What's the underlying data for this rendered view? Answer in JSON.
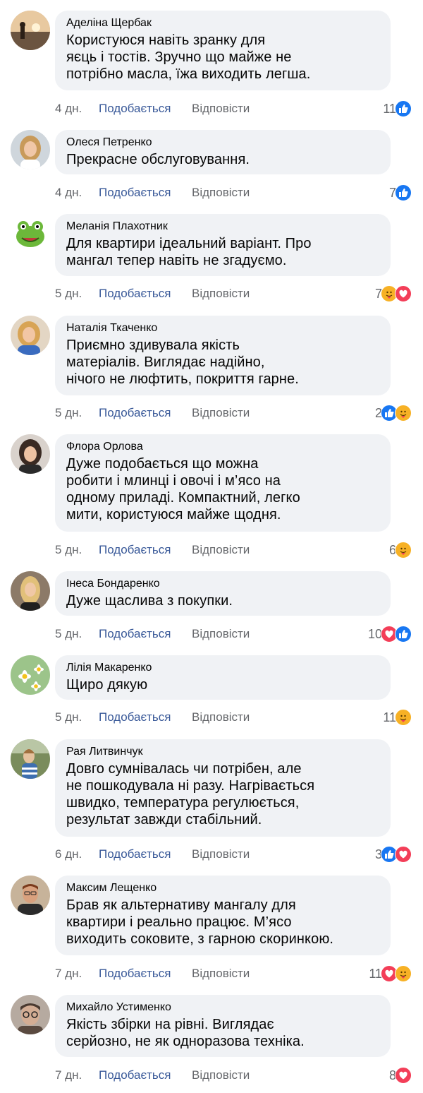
{
  "colors": {
    "bubble": "#f0f2f5",
    "like_link": "#385898",
    "meta": "#65676b",
    "like_blue": "#1877f2",
    "love_red": "#f33e58",
    "care_yellow": "#f7b125"
  },
  "comments": [
    {
      "author": "Аделіна Щербак",
      "text": "Користуюся навіть зранку для\nяєць і тостів. Зручно що майже не\nпотрібно масла, їжа виходить легша.",
      "time": "4 дн.",
      "like_label": "Подобається",
      "reply_label": "Відповісти",
      "count": "11",
      "reactions": [
        "like-icon"
      ],
      "avatar": "sunset-avatar"
    },
    {
      "author": "Олеся Петренко",
      "text": "Прекрасне обслуговування.",
      "time": "4 дн.",
      "like_label": "Подобається",
      "reply_label": "Відповісти",
      "count": "7",
      "reactions": [
        "like-icon"
      ],
      "avatar": "woman-blonde-avatar"
    },
    {
      "author": "Меланія Плахотник",
      "text": "Для квартири ідеальний варіант. Про\nмангал тепер навіть не згадуємо.",
      "time": "5 дн.",
      "like_label": "Подобається",
      "reply_label": "Відповісти",
      "count": "7",
      "reactions": [
        "care-icon",
        "love-icon"
      ],
      "avatar": "frog-avatar"
    },
    {
      "author": "Наталія Ткаченко",
      "text": "Приємно здивувала якість\nматеріалів. Виглядає надійно,\nнічого не люфтить, покриття гарне.",
      "time": "5 дн.",
      "like_label": "Подобається",
      "reply_label": "Відповісти",
      "count": "2",
      "reactions": [
        "like-icon",
        "care-icon"
      ],
      "avatar": "woman-blonde-avatar"
    },
    {
      "author": "Флора Орлова",
      "text": "Дуже подобається що можна\nробити і млинці і овочі і м’ясо на\nодному приладі. Компактний, легко\nмити, користуюся майже щодня.",
      "time": "5 дн.",
      "like_label": "Подобається",
      "reply_label": "Відповісти",
      "count": "6",
      "reactions": [
        "care-icon"
      ],
      "avatar": "woman-dark-avatar"
    },
    {
      "author": "Інеса Бондаренко",
      "text": "Дуже щаслива з покупки.",
      "time": "5 дн.",
      "like_label": "Подобається",
      "reply_label": "Відповісти",
      "count": "10",
      "reactions": [
        "love-icon",
        "like-icon"
      ],
      "avatar": "woman-blonde-avatar"
    },
    {
      "author": "Лілія Макаренко",
      "text": "Щиро дякую",
      "time": "5 дн.",
      "like_label": "Подобається",
      "reply_label": "Відповісти",
      "count": "11",
      "reactions": [
        "care-icon"
      ],
      "avatar": "daisy-avatar"
    },
    {
      "author": "Рая Литвинчук",
      "text": "Довго сумнівалась чи потрібен, але\nне пошкодувала ні разу. Нагрівається\nшвидко, температура регулюється,\nрезультат завжди стабільний.",
      "time": "6 дн.",
      "like_label": "Подобається",
      "reply_label": "Відповісти",
      "count": "3",
      "reactions": [
        "like-icon",
        "love-icon"
      ],
      "avatar": "woman-outdoor-avatar"
    },
    {
      "author": "Максим Лещенко",
      "text": "Брав як альтернативу мангалу для\nквартири і реально працює. М’ясо\nвиходить соковите, з гарною скоринкою.",
      "time": "7 дн.",
      "like_label": "Подобається",
      "reply_label": "Відповісти",
      "count": "11",
      "reactions": [
        "love-icon",
        "care-icon"
      ],
      "avatar": "man-avatar"
    },
    {
      "author": "Михайло Устименко",
      "text": "Якість збірки на рівні. Виглядає\nсерйозно, не як одноразова техніка.",
      "time": "7 дн.",
      "like_label": "Подобається",
      "reply_label": "Відповісти",
      "count": "8",
      "reactions": [
        "love-icon"
      ],
      "avatar": "man-glasses-avatar"
    }
  ]
}
